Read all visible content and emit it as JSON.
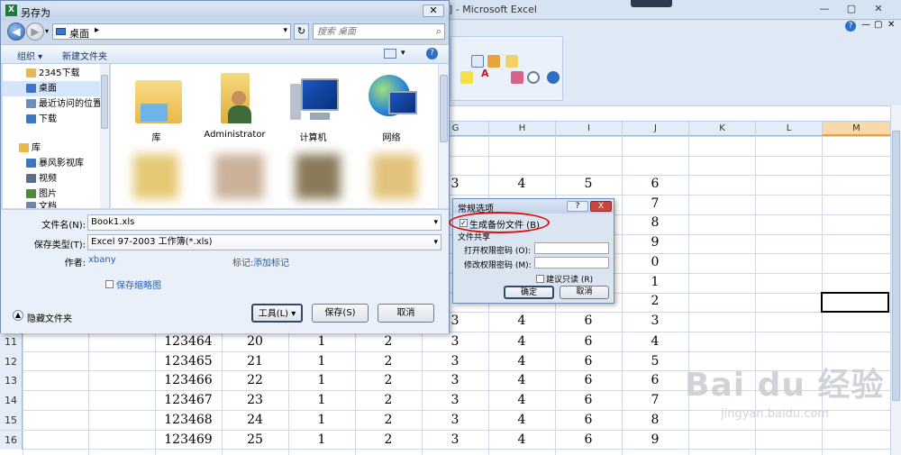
{
  "excel": {
    "title_suffix": "] - Microsoft Excel",
    "columns": [
      "G",
      "H",
      "I",
      "J",
      "K",
      "L",
      "M"
    ],
    "grid_top_values": [
      [
        "3",
        "4",
        "5",
        "6"
      ],
      [
        "",
        "",
        "",
        "7"
      ],
      [
        "",
        "",
        "",
        "8"
      ],
      [
        "",
        "",
        "",
        "9"
      ],
      [
        "",
        "",
        "",
        "0"
      ],
      [
        "",
        "",
        "",
        "1"
      ],
      [
        "",
        "",
        "",
        "2"
      ],
      [
        "3",
        "4",
        "6",
        "3"
      ]
    ],
    "rows": [
      {
        "num": "11",
        "c": "123464",
        "d": "20",
        "e": "1",
        "f": "2",
        "g": "3",
        "h": "4",
        "i": "6",
        "j": "4"
      },
      {
        "num": "12",
        "c": "123465",
        "d": "21",
        "e": "1",
        "f": "2",
        "g": "3",
        "h": "4",
        "i": "6",
        "j": "5"
      },
      {
        "num": "13",
        "c": "123466",
        "d": "22",
        "e": "1",
        "f": "2",
        "g": "3",
        "h": "4",
        "i": "6",
        "j": "6"
      },
      {
        "num": "14",
        "c": "123467",
        "d": "23",
        "e": "1",
        "f": "2",
        "g": "3",
        "h": "4",
        "i": "6",
        "j": "7"
      },
      {
        "num": "15",
        "c": "123468",
        "d": "24",
        "e": "1",
        "f": "2",
        "g": "3",
        "h": "4",
        "i": "6",
        "j": "8"
      },
      {
        "num": "16",
        "c": "123469",
        "d": "25",
        "e": "1",
        "f": "2",
        "g": "3",
        "h": "4",
        "i": "6",
        "j": "9"
      }
    ],
    "watermark_big": "Bai du 经验",
    "watermark_small": "jingyan.baidu.com"
  },
  "save_dialog": {
    "title": "另存为",
    "address": "桌面",
    "search_placeholder": "搜索 桌面",
    "toolbar": {
      "organize": "组织 ▾",
      "new_folder": "新建文件夹"
    },
    "tree": [
      {
        "label": "2345下载",
        "color": "#e8b84a"
      },
      {
        "label": "桌面",
        "color": "#3a77c9"
      },
      {
        "label": "最近访问的位置",
        "color": "#6a8fbf"
      },
      {
        "label": "下载",
        "color": "#3a77c9"
      },
      {
        "label": "库",
        "color": "#e8b84a"
      },
      {
        "label": "暴风影视库",
        "color": "#3a77c9"
      },
      {
        "label": "视频",
        "color": "#5b6f8c"
      },
      {
        "label": "图片",
        "color": "#4c8a3a"
      },
      {
        "label": "文档",
        "color": "#6d86a8"
      }
    ],
    "files": [
      {
        "label": "库"
      },
      {
        "label": "Administrator"
      },
      {
        "label": "计算机"
      },
      {
        "label": "网络"
      }
    ],
    "filename_label": "文件名(N):",
    "filename_value": "Book1.xls",
    "filetype_label": "保存类型(T):",
    "filetype_value": "Excel 97-2003 工作簿(*.xls)",
    "author_label": "作者:",
    "author_value": "xbany",
    "tags_label": "标记:",
    "tags_value": "添加标记",
    "thumbnail_label": "保存缩略图",
    "hide_folders": "隐藏文件夹",
    "tools_button": "工具(L)",
    "save_button": "保存(S)",
    "cancel_button": "取消"
  },
  "options_dialog": {
    "title": "常规选项",
    "help_glyph": "?",
    "close_glyph": "X",
    "backup_label": "生成备份文件 (B)",
    "sharing_label": "文件共享",
    "open_pw_label": "打开权限密码 (O):",
    "modify_pw_label": "修改权限密码 (M):",
    "readonly_label": "建议只读 (R)",
    "ok_button": "确定",
    "cancel_button": "取消"
  }
}
